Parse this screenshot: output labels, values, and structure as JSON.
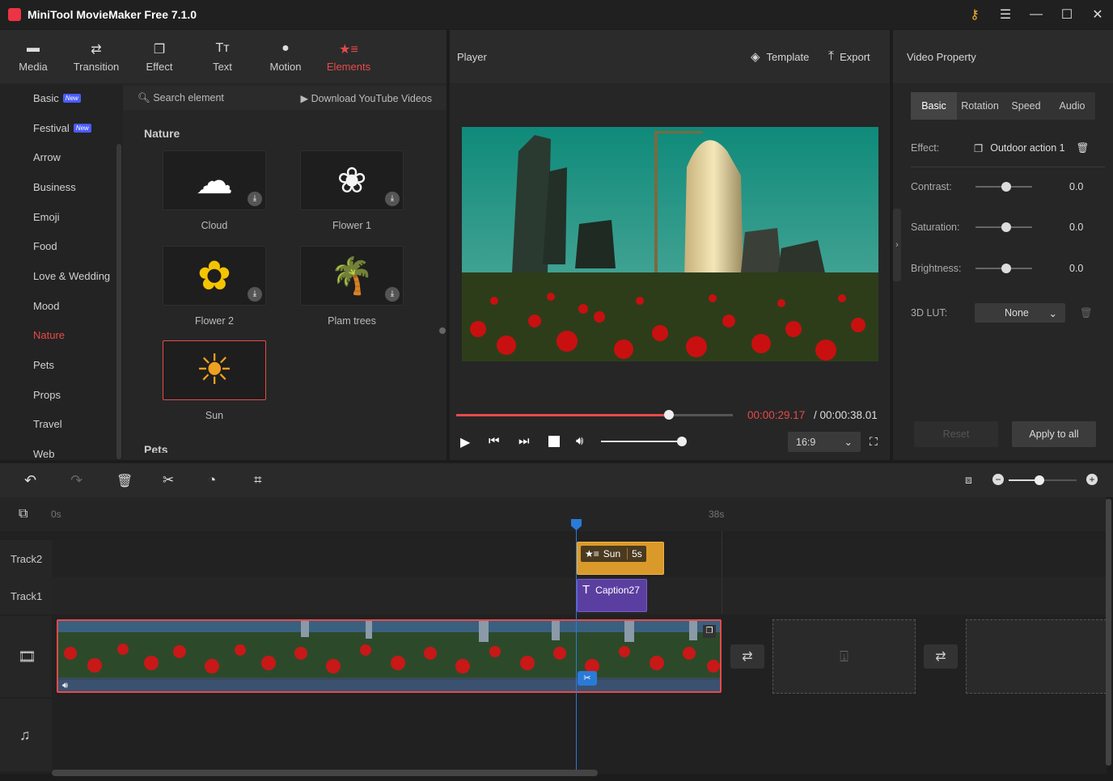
{
  "app": {
    "title": "MiniTool MovieMaker Free 7.1.0"
  },
  "tabs": [
    {
      "label": "Media",
      "icon": "folder-icon"
    },
    {
      "label": "Transition",
      "icon": "transition-icon"
    },
    {
      "label": "Effect",
      "icon": "effect-icon"
    },
    {
      "label": "Text",
      "icon": "text-icon"
    },
    {
      "label": "Motion",
      "icon": "motion-icon"
    },
    {
      "label": "Elements",
      "icon": "elements-icon",
      "active": true
    }
  ],
  "categories": [
    {
      "label": "Basic",
      "badge": "New"
    },
    {
      "label": "Festival",
      "badge": "New"
    },
    {
      "label": "Arrow"
    },
    {
      "label": "Business"
    },
    {
      "label": "Emoji"
    },
    {
      "label": "Food"
    },
    {
      "label": "Love & Wedding"
    },
    {
      "label": "Mood"
    },
    {
      "label": "Nature",
      "active": true
    },
    {
      "label": "Pets"
    },
    {
      "label": "Props"
    },
    {
      "label": "Travel"
    },
    {
      "label": "Web"
    }
  ],
  "search": {
    "placeholder": "Search element",
    "download_label": "Download YouTube Videos"
  },
  "elements": {
    "section": "Nature",
    "next_section": "Pets",
    "items": [
      {
        "label": "Cloud",
        "emoji": "☁"
      },
      {
        "label": "Flower 1",
        "emoji": "❀"
      },
      {
        "label": "Flower 2",
        "emoji": "✿"
      },
      {
        "label": "Plam trees",
        "emoji": "🌴"
      },
      {
        "label": "Sun",
        "emoji": "☀",
        "selected": true
      }
    ]
  },
  "player": {
    "title": "Player",
    "template_label": "Template",
    "export_label": "Export",
    "current_time": "00:00:29.17",
    "total_time": "/ 00:00:38.01",
    "progress": 0.77,
    "volume": 0.96,
    "aspect": "16:9"
  },
  "property": {
    "title": "Video Property",
    "tabs": [
      "Basic",
      "Rotation",
      "Speed",
      "Audio"
    ],
    "effect_label": "Effect:",
    "effect_value": "Outdoor action 1",
    "contrast_label": "Contrast:",
    "contrast_value": "0.0",
    "saturation_label": "Saturation:",
    "saturation_value": "0.0",
    "brightness_label": "Brightness:",
    "brightness_value": "0.0",
    "lut_label": "3D LUT:",
    "lut_value": "None",
    "reset_label": "Reset",
    "apply_label": "Apply to all"
  },
  "timeline": {
    "ruler_start": "0s",
    "ruler_mark": "38s",
    "track2_label": "Track2",
    "track1_label": "Track1",
    "sun_clip": "Sun",
    "sun_duration": "5s",
    "caption_clip": "Caption27"
  },
  "colors": {
    "accent": "#e84a4a",
    "playhead": "#2a7ad8",
    "sun_clip": "#d99a2b",
    "caption_clip": "#5b3fa0"
  }
}
